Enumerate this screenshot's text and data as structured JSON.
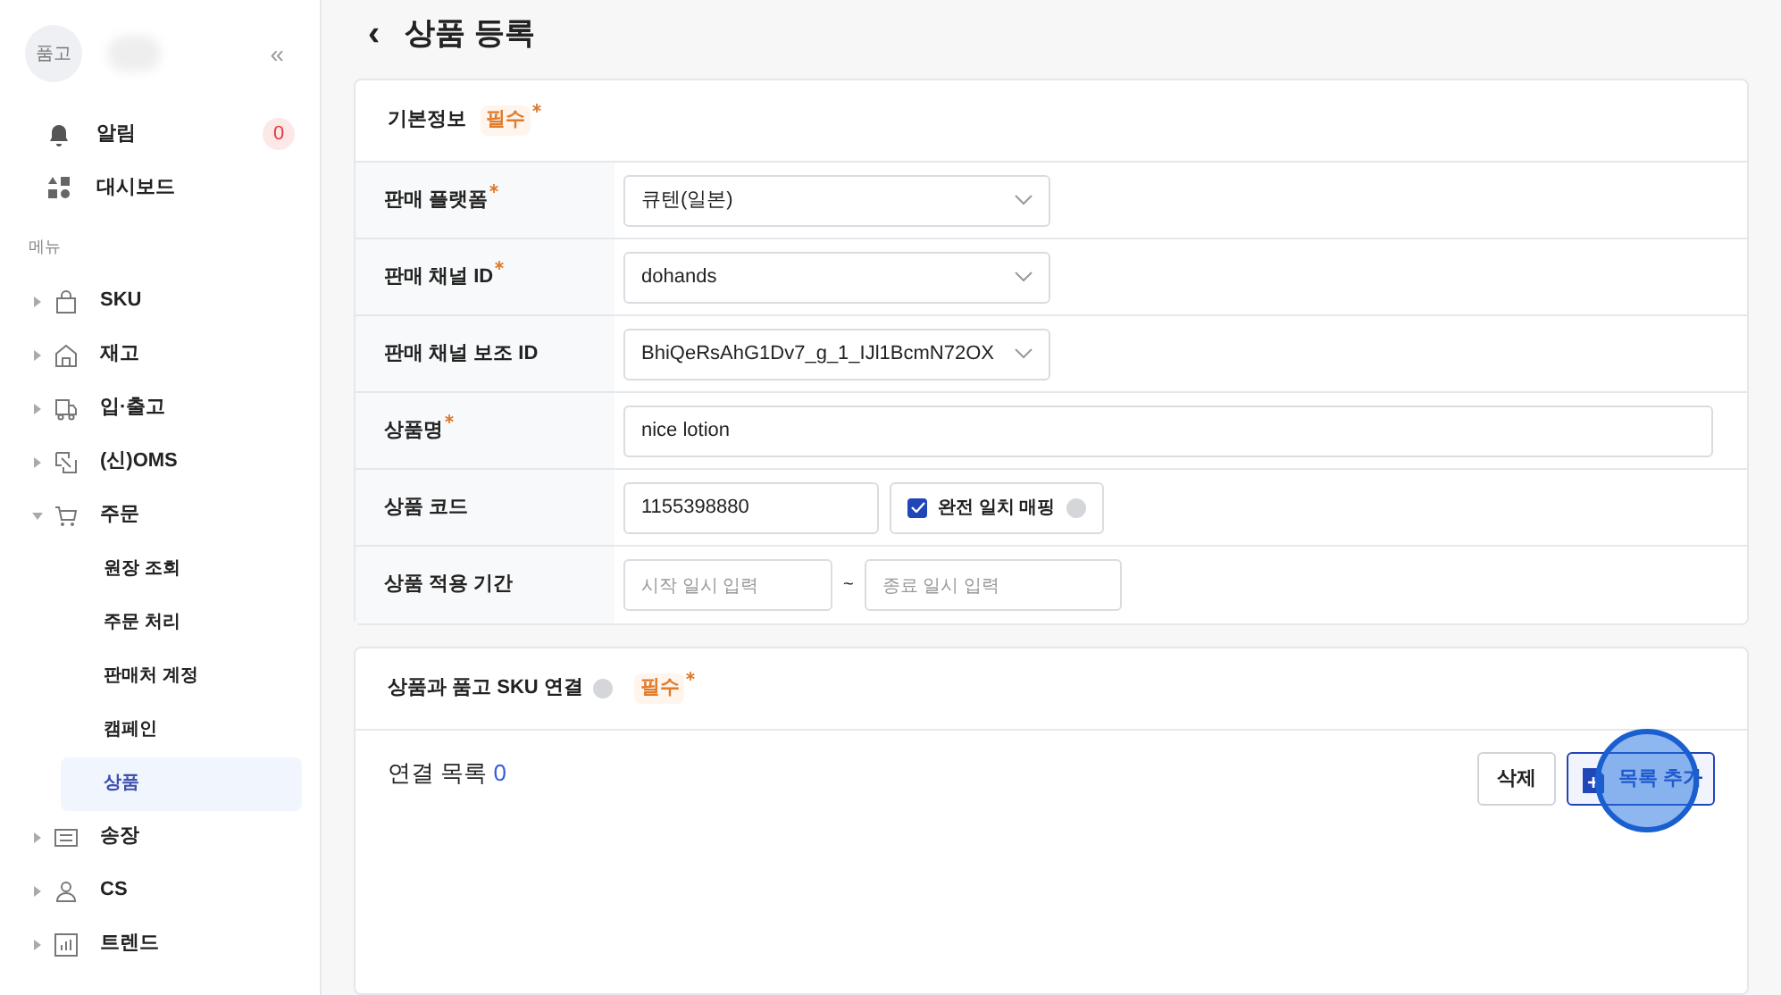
{
  "sidebar": {
    "avatar": "품고",
    "collapse": "«",
    "top_items": [
      {
        "label": "알림",
        "badge": "0"
      },
      {
        "label": "대시보드"
      }
    ],
    "section": "메뉴",
    "menu": [
      {
        "label": "SKU",
        "expanded": false
      },
      {
        "label": "재고",
        "expanded": false
      },
      {
        "label": "입·출고",
        "expanded": false
      },
      {
        "label": "(신)OMS",
        "expanded": false
      },
      {
        "label": "주문",
        "expanded": true,
        "children": [
          {
            "label": "원장 조회",
            "selected": false
          },
          {
            "label": "주문 처리",
            "selected": false
          },
          {
            "label": "판매처 계정",
            "selected": false
          },
          {
            "label": "캠페인",
            "selected": false
          },
          {
            "label": "상품",
            "selected": true
          }
        ]
      },
      {
        "label": "송장",
        "expanded": false
      },
      {
        "label": "CS",
        "expanded": false
      },
      {
        "label": "트렌드",
        "expanded": false
      }
    ]
  },
  "page": {
    "back": "‹",
    "title": "상품 등록"
  },
  "basic": {
    "title": "기본정보",
    "required": "필수",
    "fields": [
      {
        "label": "판매 플랫폼",
        "required": true,
        "kind": "select",
        "value": "큐텐(일본)"
      },
      {
        "label": "판매 채널 ID",
        "required": true,
        "kind": "select",
        "value": "dohands"
      },
      {
        "label": "판매 채널 보조 ID",
        "required": false,
        "kind": "select",
        "value": "BhiQeRsAhG1Dv7_g_1_IJl1BcmN72OX"
      },
      {
        "label": "상품명",
        "required": true,
        "kind": "text",
        "value": "nice lotion"
      },
      {
        "label": "상품 코드",
        "required": false,
        "kind": "code",
        "value": "1155398880",
        "check": {
          "label": "완전 일치 매핑",
          "checked": true
        }
      },
      {
        "label": "상품 적용 기간",
        "required": false,
        "kind": "range",
        "start_placeholder": "시작 일시 입력",
        "separator": "~",
        "end_placeholder": "종료 일시 입력"
      }
    ]
  },
  "sku": {
    "title": "상품과 품고 SKU 연결",
    "required": "필수",
    "list_label": "연결 목록",
    "count": "0",
    "buttons": [
      {
        "label": "삭제",
        "kind": "plain"
      },
      {
        "label": "목록 추가",
        "kind": "primary"
      }
    ]
  }
}
